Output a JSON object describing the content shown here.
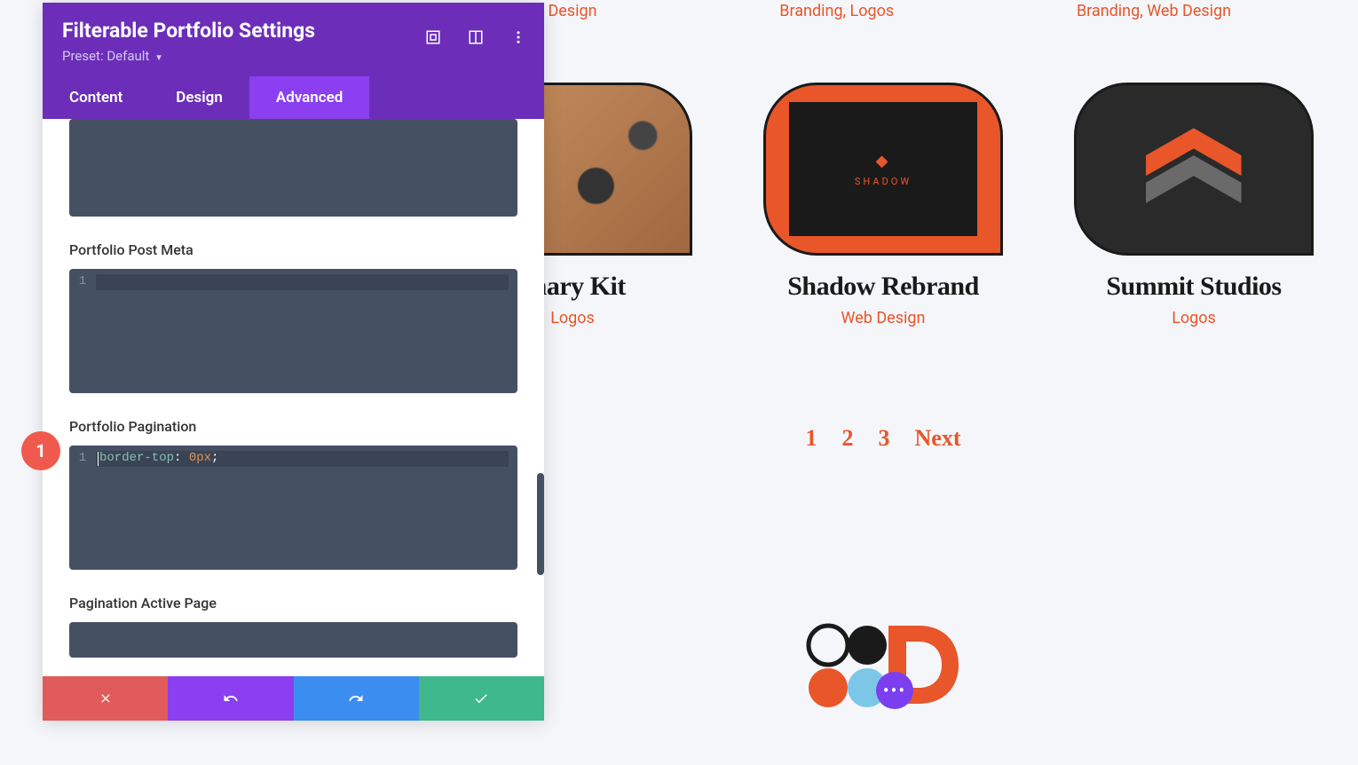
{
  "panel": {
    "title": "Filterable Portfolio Settings",
    "preset_label": "Preset: Default",
    "tabs": {
      "content": "Content",
      "design": "Design",
      "advanced": "Advanced"
    },
    "fields": {
      "post_meta_label": "Portfolio Post Meta",
      "post_meta_line1": "1",
      "pagination_label": "Portfolio Pagination",
      "pagination_line1": "1",
      "pagination_code": {
        "prop": "border-top",
        "value": "0px"
      },
      "active_page_label": "Pagination Active Page"
    }
  },
  "annotation": {
    "number": "1"
  },
  "preview": {
    "top_tags": {
      "col1": "b Design",
      "col2": "Branding, Logos",
      "col3": "Branding, Web Design"
    },
    "items": [
      {
        "title": "onary Kit",
        "meta": "Logos"
      },
      {
        "title": "Shadow Rebrand",
        "meta": "Web Design",
        "brand": "SHADOW"
      },
      {
        "title": "Summit Studios",
        "meta": "Logos"
      }
    ],
    "pagination": {
      "p1": "1",
      "p2": "2",
      "p3": "3",
      "next": "Next"
    }
  }
}
